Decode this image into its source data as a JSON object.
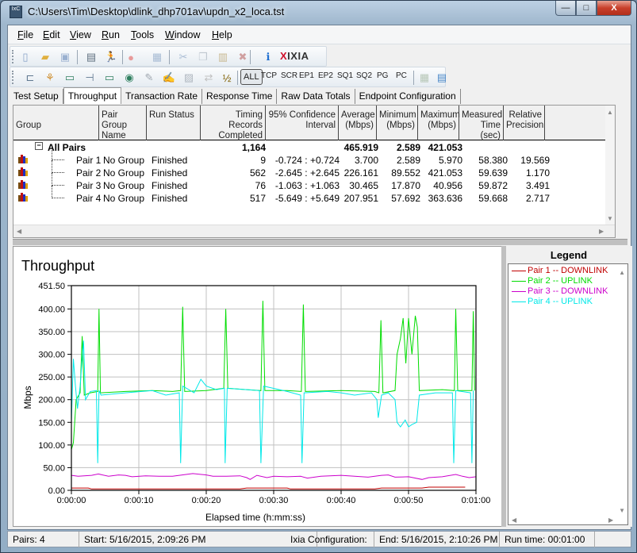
{
  "window": {
    "title": "C:\\Users\\Tim\\Desktop\\dlink_dhp701av\\updn_x2_loca.tst",
    "app_icon_label": "IxC",
    "controls": {
      "minimize": "—",
      "maximize": "□",
      "close": "X"
    }
  },
  "menu": [
    {
      "label": "File",
      "accel": "F",
      "rest": "ile"
    },
    {
      "label": "Edit",
      "accel": "E",
      "rest": "dit"
    },
    {
      "label": "View",
      "accel": "V",
      "rest": "iew"
    },
    {
      "label": "Run",
      "accel": "R",
      "rest": "un"
    },
    {
      "label": "Tools",
      "accel": "T",
      "rest": "ools"
    },
    {
      "label": "Window",
      "accel": "W",
      "rest": "indow"
    },
    {
      "label": "Help",
      "accel": "H",
      "rest": "elp"
    }
  ],
  "toolbar1": {
    "icons": [
      "new-file-icon",
      "open-folder-icon",
      "save-icon",
      "print-icon",
      "run-icon",
      "stop-icon",
      "compare-icon",
      "cut-icon",
      "copy-icon",
      "paste-icon",
      "delete-icon",
      "info-icon"
    ],
    "brand": {
      "x": "X",
      "name": "IXIA"
    }
  },
  "toolbar2": {
    "icons": [
      "add-pair-icon",
      "add-multicast-icon",
      "edit-endpoint-icon",
      "add-group-icon",
      "endpoint-monitor-icon",
      "broadcast-icon",
      "edit-script-icon",
      "sign-icon",
      "lock-icon",
      "swap-icon",
      "pair-numbers-icon"
    ],
    "filters": [
      "ALL",
      "TCP",
      "SCR",
      "EP1",
      "EP2",
      "SQ1",
      "SQ2",
      "PG",
      "PC"
    ],
    "active_filter": "ALL",
    "trailing_icons": [
      "export-icon",
      "window-icon"
    ]
  },
  "tabs": [
    {
      "label": "Test Setup",
      "active": false
    },
    {
      "label": "Throughput",
      "active": true
    },
    {
      "label": "Transaction Rate",
      "active": false
    },
    {
      "label": "Response Time",
      "active": false
    },
    {
      "label": "Raw Data Totals",
      "active": false
    },
    {
      "label": "Endpoint Configuration",
      "active": false
    }
  ],
  "grid": {
    "columns": [
      {
        "l1": "",
        "l2": "Group"
      },
      {
        "l1": "Pair Group",
        "l2": "Name"
      },
      {
        "l1": "",
        "l2": "Run Status"
      },
      {
        "l1": "Timing Records",
        "l2": "Completed"
      },
      {
        "l1": "95% Confidence",
        "l2": "Interval"
      },
      {
        "l1": "Average",
        "l2": "(Mbps)"
      },
      {
        "l1": "Minimum",
        "l2": "(Mbps)"
      },
      {
        "l1": "Maximum",
        "l2": "(Mbps)"
      },
      {
        "l1": "Measured",
        "l2": "Time (sec)"
      },
      {
        "l1": "Relative",
        "l2": "Precision"
      }
    ],
    "summary": {
      "group": "All Pairs",
      "toggle": "−",
      "records": "1,164",
      "average": "465.919",
      "minimum": "2.589",
      "maximum": "421.053"
    },
    "rows": [
      {
        "group": "Pair 1",
        "pair_group": "No Group",
        "status": "Finished",
        "records": "9",
        "ci": "-0.724 : +0.724",
        "average": "3.700",
        "minimum": "2.589",
        "maximum": "5.970",
        "time": "58.380",
        "precision": "19.569"
      },
      {
        "group": "Pair 2",
        "pair_group": "No Group",
        "status": "Finished",
        "records": "562",
        "ci": "-2.645 : +2.645",
        "average": "226.161",
        "minimum": "89.552",
        "maximum": "421.053",
        "time": "59.639",
        "precision": "1.170"
      },
      {
        "group": "Pair 3",
        "pair_group": "No Group",
        "status": "Finished",
        "records": "76",
        "ci": "-1.063 : +1.063",
        "average": "30.465",
        "minimum": "17.870",
        "maximum": "40.956",
        "time": "59.872",
        "precision": "3.491"
      },
      {
        "group": "Pair 4",
        "pair_group": "No Group",
        "status": "Finished",
        "records": "517",
        "ci": "-5.649 : +5.649",
        "average": "207.951",
        "minimum": "57.692",
        "maximum": "363.636",
        "time": "59.668",
        "precision": "2.717"
      }
    ]
  },
  "chart_data": {
    "type": "line",
    "title": "Throughput",
    "xlabel": "Elapsed time (h:mm:ss)",
    "ylabel": "Mbps",
    "xlim": [
      0,
      60
    ],
    "ylim": [
      0,
      451.5
    ],
    "x_ticks": [
      "0:00:00",
      "0:00:10",
      "0:00:20",
      "0:00:30",
      "0:00:40",
      "0:00:50",
      "0:01:00"
    ],
    "y_ticks": [
      "0.00",
      "50.00",
      "100.00",
      "150.00",
      "200.00",
      "250.00",
      "300.00",
      "350.00",
      "400.00",
      "451.50"
    ],
    "grid": true,
    "legend_title": "Legend",
    "series": [
      {
        "name": "Pair 1 -- DOWNLINK",
        "color": "#c00000",
        "points": [
          [
            0,
            5
          ],
          [
            2.5,
            5
          ],
          [
            3,
            3
          ],
          [
            20,
            3
          ],
          [
            25,
            3
          ],
          [
            26,
            5
          ],
          [
            32,
            5
          ],
          [
            32.5,
            3
          ],
          [
            45,
            3
          ],
          [
            46,
            5
          ],
          [
            52,
            5
          ],
          [
            53,
            7
          ],
          [
            58.4,
            7
          ]
        ]
      },
      {
        "name": "Pair 2 -- UPLINK",
        "color": "#00dd00",
        "points": [
          [
            0,
            90
          ],
          [
            0.3,
            105
          ],
          [
            0.7,
            200
          ],
          [
            1.3,
            215
          ],
          [
            1.6,
            340
          ],
          [
            1.9,
            210
          ],
          [
            2.8,
            215
          ],
          [
            3.9,
            218
          ],
          [
            4.1,
            400
          ],
          [
            4.3,
            215
          ],
          [
            8,
            218
          ],
          [
            12,
            220
          ],
          [
            15,
            218
          ],
          [
            16.2,
            220
          ],
          [
            16.5,
            405
          ],
          [
            16.8,
            218
          ],
          [
            20,
            220
          ],
          [
            22.6,
            225
          ],
          [
            22.9,
            400
          ],
          [
            23.2,
            225
          ],
          [
            26,
            222
          ],
          [
            28.1,
            220
          ],
          [
            28.4,
            418
          ],
          [
            28.7,
            220
          ],
          [
            32,
            220
          ],
          [
            34.1,
            218
          ],
          [
            34.4,
            410
          ],
          [
            34.7,
            218
          ],
          [
            40,
            220
          ],
          [
            45,
            218
          ],
          [
            45.6,
            215
          ],
          [
            45.9,
            375
          ],
          [
            46.2,
            215
          ],
          [
            48,
            220
          ],
          [
            48.3,
            300
          ],
          [
            48.8,
            335
          ],
          [
            49.2,
            380
          ],
          [
            49.6,
            280
          ],
          [
            50,
            380
          ],
          [
            50.5,
            300
          ],
          [
            51,
            385
          ],
          [
            51.3,
            360
          ],
          [
            51.6,
            220
          ],
          [
            55,
            222
          ],
          [
            56.8,
            220
          ],
          [
            57,
            400
          ],
          [
            57.3,
            220
          ],
          [
            59.4,
            220
          ],
          [
            59.6,
            395
          ],
          [
            59.8,
            220
          ]
        ]
      },
      {
        "name": "Pair 3 -- DOWNLINK",
        "color": "#cc00cc",
        "points": [
          [
            0,
            33
          ],
          [
            1,
            31
          ],
          [
            3,
            33
          ],
          [
            4,
            36
          ],
          [
            5.5,
            31
          ],
          [
            7,
            34
          ],
          [
            8,
            33
          ],
          [
            9,
            30
          ],
          [
            11,
            32
          ],
          [
            13,
            31
          ],
          [
            15,
            31
          ],
          [
            17,
            35
          ],
          [
            18,
            37
          ],
          [
            20,
            34
          ],
          [
            21,
            31
          ],
          [
            23,
            31
          ],
          [
            25,
            32
          ],
          [
            26,
            28
          ],
          [
            26.5,
            24
          ],
          [
            27.5,
            33
          ],
          [
            29,
            28
          ],
          [
            30,
            31
          ],
          [
            32,
            30
          ],
          [
            34,
            31
          ],
          [
            35,
            27
          ],
          [
            37,
            31
          ],
          [
            40,
            33
          ],
          [
            42,
            31
          ],
          [
            44,
            29
          ],
          [
            46,
            33
          ],
          [
            47,
            34
          ],
          [
            48,
            29
          ],
          [
            50,
            30
          ],
          [
            52,
            24
          ],
          [
            53,
            28
          ],
          [
            55,
            30
          ],
          [
            57,
            35
          ],
          [
            58,
            31
          ],
          [
            59,
            28
          ],
          [
            60,
            30
          ]
        ]
      },
      {
        "name": "Pair 4 -- UPLINK",
        "color": "#00e8e8",
        "points": [
          [
            0,
            150
          ],
          [
            0.3,
            290
          ],
          [
            0.6,
            230
          ],
          [
            0.9,
            180
          ],
          [
            1.3,
            230
          ],
          [
            1.8,
            330
          ],
          [
            2.1,
            200
          ],
          [
            2.8,
            218
          ],
          [
            3.7,
            220
          ],
          [
            3.9,
            60
          ],
          [
            4.1,
            220
          ],
          [
            4.4,
            210
          ],
          [
            8,
            215
          ],
          [
            12,
            220
          ],
          [
            14,
            210
          ],
          [
            16,
            215
          ],
          [
            16.2,
            60
          ],
          [
            16.5,
            230
          ],
          [
            18.2,
            215
          ],
          [
            19.2,
            245
          ],
          [
            20,
            230
          ],
          [
            21.5,
            222
          ],
          [
            22.7,
            225
          ],
          [
            22.8,
            60
          ],
          [
            23.1,
            225
          ],
          [
            26,
            222
          ],
          [
            27.9,
            220
          ],
          [
            28.1,
            60
          ],
          [
            28.5,
            230
          ],
          [
            32,
            218
          ],
          [
            34,
            210
          ],
          [
            34.2,
            60
          ],
          [
            34.5,
            215
          ],
          [
            38,
            218
          ],
          [
            40,
            215
          ],
          [
            42,
            210
          ],
          [
            44.5,
            215
          ],
          [
            45.3,
            200
          ],
          [
            45.5,
            160
          ],
          [
            46,
            210
          ],
          [
            47,
            215
          ],
          [
            48,
            200
          ],
          [
            48.3,
            150
          ],
          [
            48.8,
            140
          ],
          [
            49.5,
            155
          ],
          [
            50,
            140
          ],
          [
            50.5,
            145
          ],
          [
            51.2,
            150
          ],
          [
            51.6,
            210
          ],
          [
            54,
            215
          ],
          [
            56.5,
            215
          ],
          [
            56.7,
            60
          ],
          [
            57,
            220
          ],
          [
            59.2,
            215
          ],
          [
            59.4,
            60
          ],
          [
            59.6,
            220
          ]
        ]
      }
    ]
  },
  "status_bar": {
    "pairs": "Pairs: 4",
    "start": "Start: 5/16/2015, 2:09:26 PM",
    "ixia_config": "Ixia Configuration:",
    "end": "End: 5/16/2015, 2:10:26 PM",
    "run_time": "Run time: 00:01:00"
  }
}
